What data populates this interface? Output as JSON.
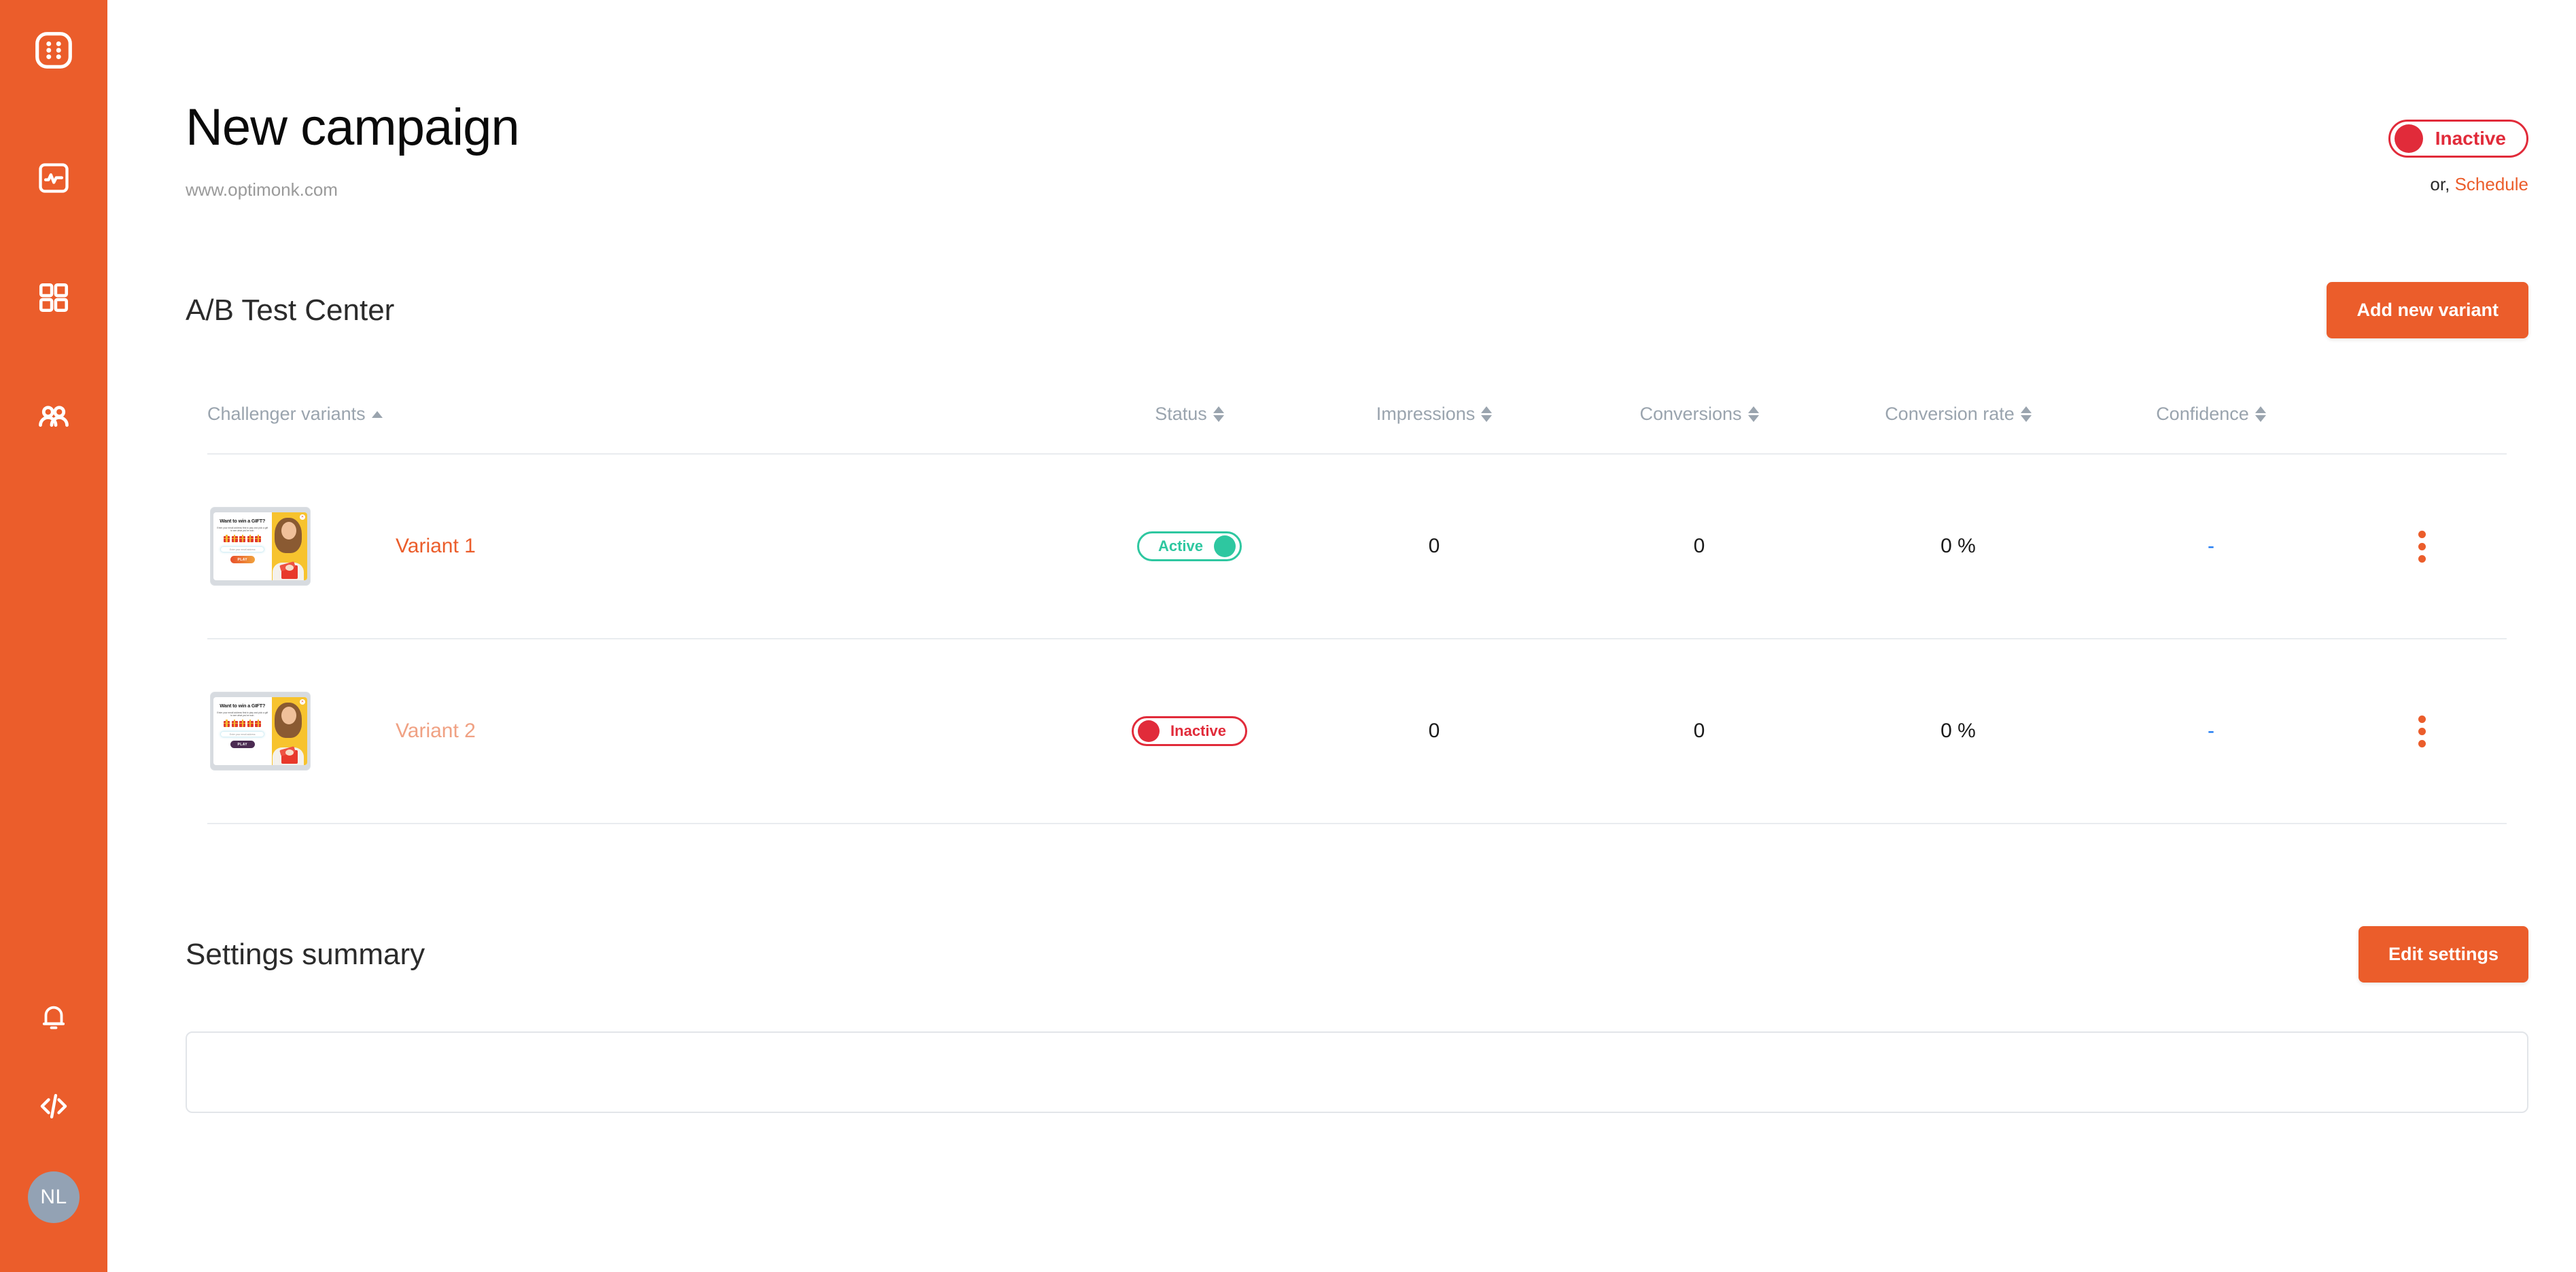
{
  "brand": {
    "accent": "#EB5D2B",
    "green": "#2EC7A0",
    "red": "#E12B3A",
    "link_blue": "#1877F2"
  },
  "sidebar": {
    "logo_name": "optimonk-logo-icon",
    "items": [
      {
        "name": "analytics-icon",
        "label": "Analytics"
      },
      {
        "name": "campaigns-grid-icon",
        "label": "Campaigns"
      },
      {
        "name": "audience-people-icon",
        "label": "Audience"
      }
    ],
    "bottom": [
      {
        "name": "notifications-bell-icon",
        "label": "Notifications"
      },
      {
        "name": "embed-code-icon",
        "label": "Embed code"
      }
    ],
    "avatar_initials": "NL"
  },
  "header": {
    "title": "New campaign",
    "url": "www.optimonk.com",
    "status_toggle": {
      "label": "Inactive",
      "state": "inactive"
    },
    "or_text": "or,",
    "schedule_label": "Schedule"
  },
  "ab_section": {
    "title": "A/B Test Center",
    "add_variant_label": "Add new variant",
    "columns": [
      {
        "key": "variant",
        "label": "Challenger variants",
        "sort": "asc"
      },
      {
        "key": "status",
        "label": "Status",
        "sort": "both"
      },
      {
        "key": "impressions",
        "label": "Impressions",
        "sort": "both"
      },
      {
        "key": "conversions",
        "label": "Conversions",
        "sort": "both"
      },
      {
        "key": "rate",
        "label": "Conversion rate",
        "sort": "both"
      },
      {
        "key": "confidence",
        "label": "Confidence",
        "sort": "both"
      }
    ],
    "rows": [
      {
        "name": "Variant 1",
        "name_faded": false,
        "status": "Active",
        "status_state": "active",
        "impressions": "0",
        "conversions": "0",
        "conversion_rate": "0 %",
        "confidence": "-",
        "thumbnail": {
          "heading": "Want to win a GIFT?",
          "body": "Enter your email address first to play and pick a gift to see what you've won.",
          "input_placeholder": "Enter your email address",
          "button_label": "PLAY",
          "button_style": "orange",
          "gift_count": 5
        }
      },
      {
        "name": "Variant 2",
        "name_faded": true,
        "status": "Inactive",
        "status_state": "inactive",
        "impressions": "0",
        "conversions": "0",
        "conversion_rate": "0 %",
        "confidence": "-",
        "thumbnail": {
          "heading": "Want to win a GIFT?",
          "body": "Enter your email address first to play and pick a gift to see what you've won.",
          "input_placeholder": "Enter your email address",
          "button_label": "PLAY",
          "button_style": "purple",
          "gift_count": 5
        }
      }
    ]
  },
  "settings_section": {
    "title": "Settings summary",
    "edit_label": "Edit settings"
  }
}
